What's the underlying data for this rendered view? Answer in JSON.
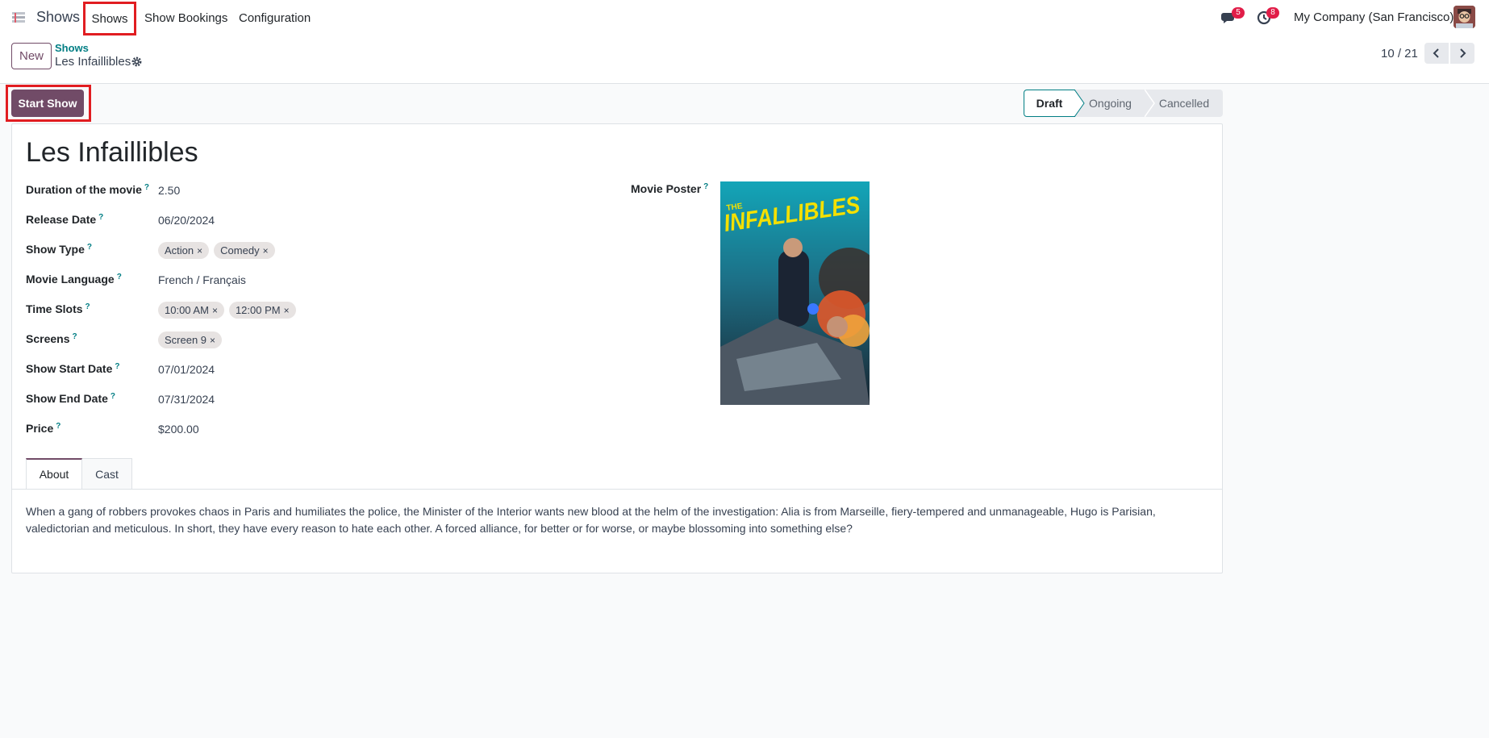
{
  "navbar": {
    "app_name": "Shows",
    "menu": [
      "Shows",
      "Show Bookings",
      "Configuration"
    ],
    "messages_count": "5",
    "activities_count": "8",
    "company": "My Company (San Francisco)"
  },
  "control_panel": {
    "new_label": "New",
    "breadcrumb_parent": "Shows",
    "breadcrumb_current": "Les Infaillibles",
    "pager": "10 / 21"
  },
  "header": {
    "start_label": "Start Show",
    "stages": [
      "Draft",
      "Ongoing",
      "Cancelled"
    ],
    "active_stage": "Draft"
  },
  "record": {
    "title": "Les Infaillibles",
    "fields": {
      "duration": {
        "label": "Duration of the movie",
        "value": "2.50"
      },
      "release_date": {
        "label": "Release Date",
        "value": "06/20/2024"
      },
      "show_type": {
        "label": "Show Type",
        "tags": [
          "Action",
          "Comedy"
        ]
      },
      "language": {
        "label": "Movie Language",
        "value": "French / Français"
      },
      "time_slots": {
        "label": "Time Slots",
        "tags": [
          "10:00 AM",
          "12:00 PM"
        ]
      },
      "screens": {
        "label": "Screens",
        "tags": [
          "Screen 9"
        ]
      },
      "start_date": {
        "label": "Show Start Date",
        "value": "07/01/2024"
      },
      "end_date": {
        "label": "Show End Date",
        "value": "07/31/2024"
      },
      "price": {
        "label": "Price",
        "value": "$200.00"
      }
    },
    "poster_label": "Movie Poster",
    "poster_text": {
      "small": "THE",
      "title": "INFALLIBLES"
    },
    "tip_mark": "?",
    "tag_remove": "×"
  },
  "tabs": {
    "about": "About",
    "cast": "Cast",
    "about_text": "When a gang of robbers provokes chaos in Paris and humiliates the police, the Minister of the Interior wants new blood at the helm of the investigation: Alia is from Marseille, fiery-tempered and unmanageable, Hugo is Parisian, valedictorian and meticulous. In short, they have every reason to hate each other. A forced alliance, for better or for worse, or maybe blossoming into something else?"
  },
  "colors": {
    "brand": "#714b67",
    "teal": "#017e84",
    "highlight": "#e11d21"
  }
}
